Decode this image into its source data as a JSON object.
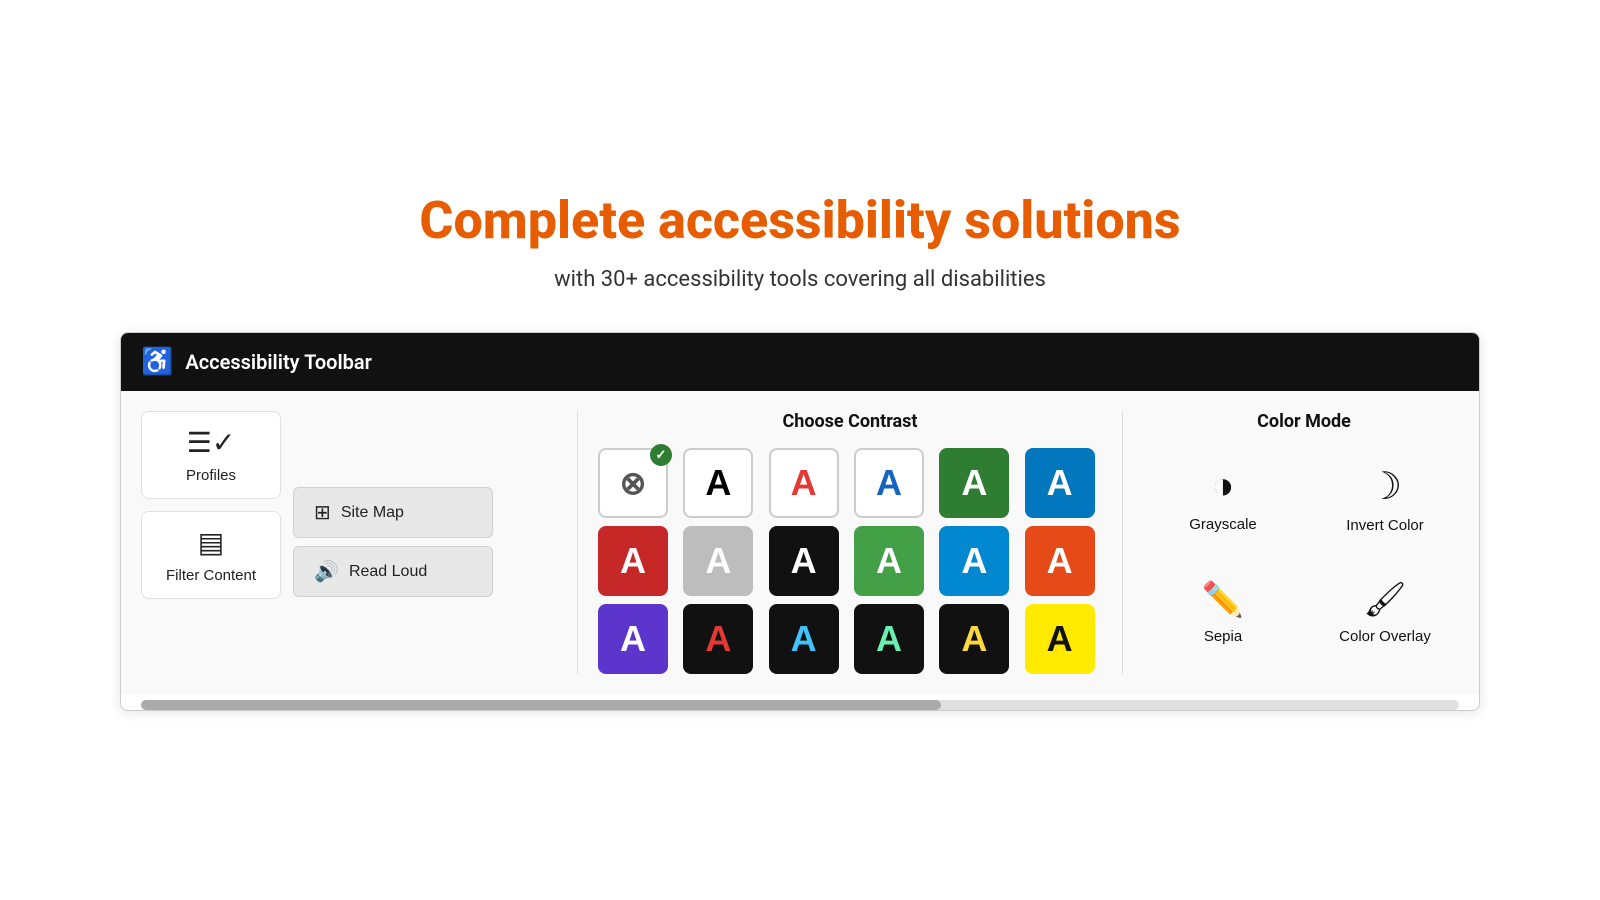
{
  "hero": {
    "title": "Complete accessibility solutions",
    "subtitle": "with 30+ accessibility tools covering all disabilities"
  },
  "toolbar": {
    "header_icon": "♿",
    "header_title": "Accessibility Toolbar",
    "left": {
      "profiles_label": "Profiles",
      "filter_label": "Filter Content",
      "site_map_label": "Site Map",
      "read_loud_label": "Read Loud"
    },
    "contrast": {
      "title": "Choose Contrast"
    },
    "color_mode": {
      "title": "Color Mode",
      "grayscale_label": "Grayscale",
      "invert_label": "Invert Color",
      "sepia_label": "Sepia",
      "overlay_label": "Color Overlay"
    }
  }
}
